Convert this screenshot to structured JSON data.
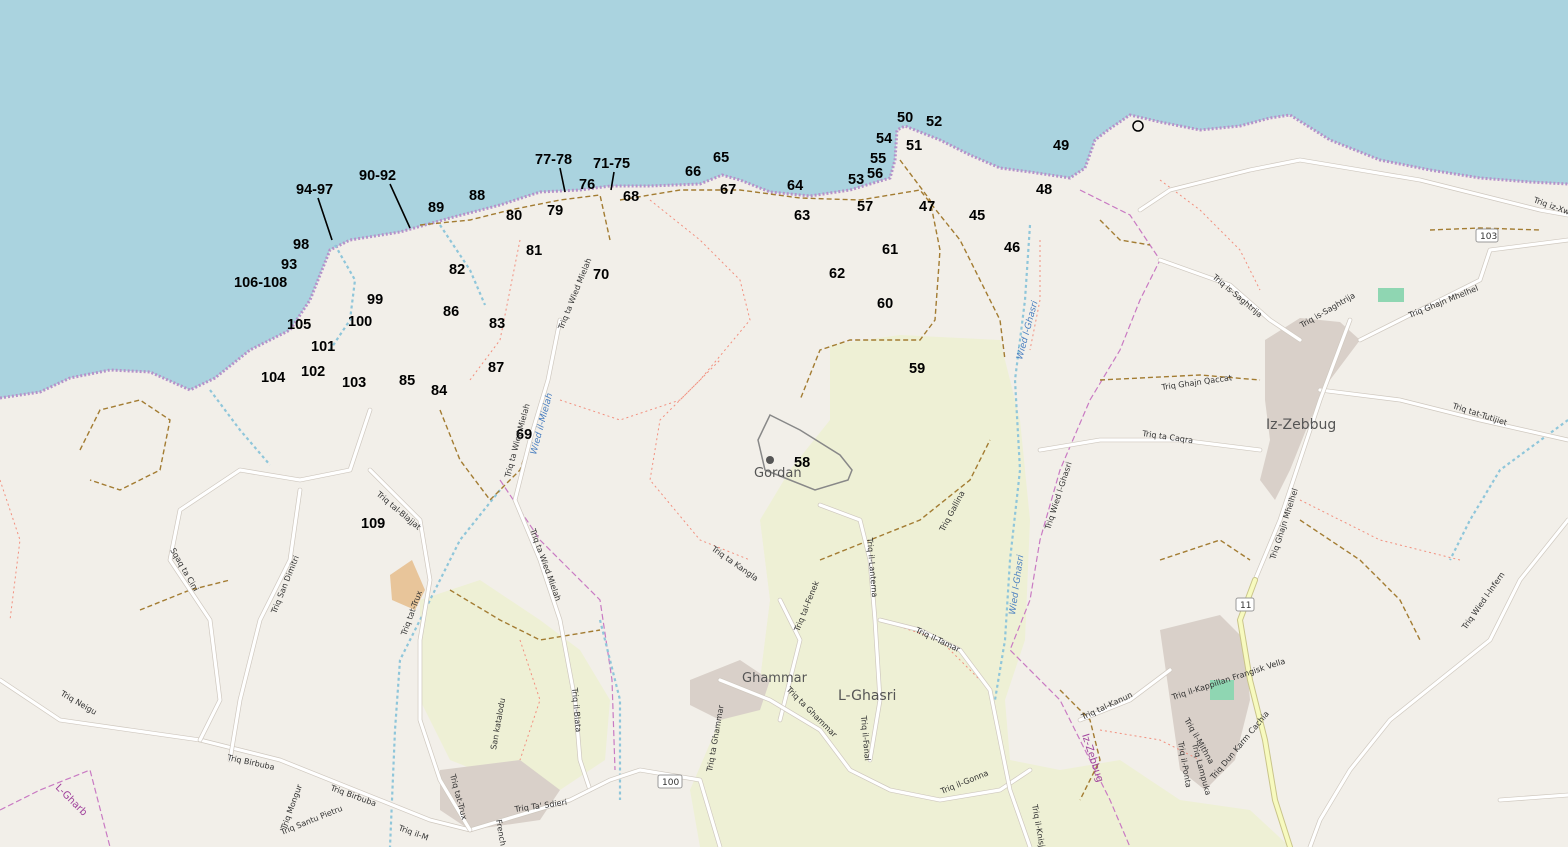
{
  "map": {
    "colors": {
      "sea": "#aad3df",
      "land": "#f2efe9",
      "farmland": "#eef0d5",
      "road": "#ffffff",
      "main_road": "#f7fabf",
      "track": "#a37c32",
      "coast_dots": "#b592c9",
      "built": "#d9d0c9"
    },
    "markers": [
      "50",
      "52",
      "54",
      "51",
      "49",
      "55",
      "56",
      "53",
      "65",
      "66",
      "67",
      "64",
      "57",
      "47",
      "45",
      "48",
      "63",
      "46",
      "61",
      "62",
      "60",
      "59",
      "58",
      "77-78",
      "71-75",
      "76",
      "68",
      "79",
      "80",
      "88",
      "89",
      "90-92",
      "94-97",
      "98",
      "93",
      "106-108",
      "82",
      "81",
      "70",
      "99",
      "86",
      "83",
      "100",
      "105",
      "101",
      "102",
      "104",
      "103",
      "85",
      "87",
      "84",
      "69",
      "109"
    ],
    "places": {
      "iz_zebbug": "Iz-Zebbug",
      "l_ghasri": "L-Ghasri",
      "ghammar": "Ghammar",
      "gordan": "Gordan"
    },
    "streets": [
      "Triq ta Wied Mielah",
      "Triq ta Wied Mielah",
      "Triq ta Wied Mielah",
      "Triq tal-Blajjat",
      "Triq San Dimitri",
      "Triq tat-Trux",
      "Triq ta Kangla",
      "Triq tal-Fenek",
      "Triq il-Lanterna",
      "Triq Gallina",
      "Triq il-Tamar",
      "Triq ta Ghammar",
      "Triq il-Fanal",
      "Triq il-Gonna",
      "Triq ta Ghammar",
      "Triq Ta' Sdieri",
      "Triq il-Blata",
      "San katalodu",
      "Triq tat-Trux",
      "Triq Birbuba",
      "Triq Birbuba",
      "Triq Neigu",
      "Sqaq ta Cini",
      "Triq Santu Pietru",
      "Triq Mongur",
      "Triq Wied l-Ghasri",
      "Triq ta Caqra",
      "Triq Ghajn Qaccat",
      "Triq Ghajn Mhelhel",
      "Triq Ghajn Mhelhel",
      "Triq is-Saghtrija",
      "Triq is-Saghtrija",
      "Triq tat-Tutijiet",
      "Triq Wied l-Infern",
      "Triq il-Kappillan Frangisk Vella",
      "Triq tal-Kanun",
      "Triq il-Mithna",
      "Triq il-Ponta",
      "Triq Lampuka",
      "Triq Dun Karm Cachia",
      "Triq iz-Xwejni",
      "French",
      "Triq il-M",
      "Triq il-Knisja"
    ],
    "valleys": [
      "Wied il-Mielah",
      "Wied l-Ghasri",
      "Wied l-Ghasri"
    ],
    "admin_labels": [
      "Iz-Zebbug",
      "L-Gharb"
    ],
    "road_shields": [
      "103",
      "11",
      "100"
    ]
  }
}
